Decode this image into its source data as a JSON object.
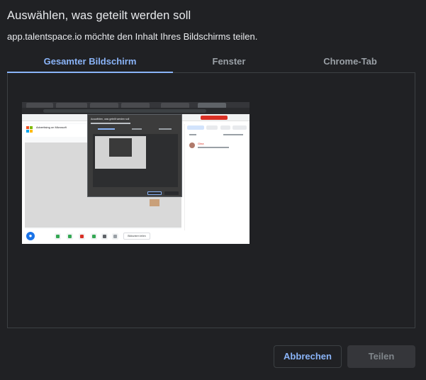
{
  "dialog": {
    "title": "Auswählen, was geteilt werden soll",
    "subtitle": "app.talentspace.io möchte den Inhalt Ihres Bildschirms teilen."
  },
  "tabs": [
    {
      "label": "Gesamter Bildschirm",
      "active": true
    },
    {
      "label": "Fenster",
      "active": false
    },
    {
      "label": "Chrome-Tab",
      "active": false
    }
  ],
  "screen_preview": {
    "page_heading": "Advertising on Microsoft",
    "sidebar_entry": "Gina",
    "dialog_title": "Auswählen, was geteilt werden soll",
    "bottom_button": "Bildschirm teilen"
  },
  "buttons": {
    "cancel_label": "Abbrechen",
    "share_label": "Teilen",
    "share_disabled": true
  },
  "colors": {
    "background": "#202124",
    "accent": "#8ab4f8",
    "border": "#3c4043",
    "disabled_text": "#80868b"
  }
}
